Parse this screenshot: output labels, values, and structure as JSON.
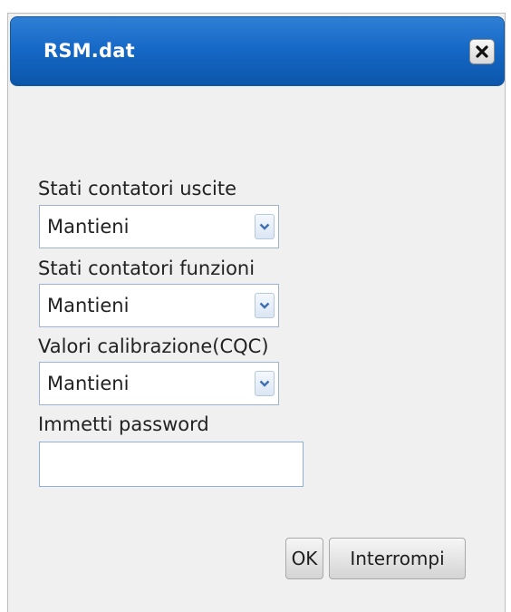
{
  "dialog": {
    "title": "RSM.dat",
    "close_icon": "close-x-icon"
  },
  "fields": [
    {
      "label": "Stati contatori uscite",
      "value": "Mantieni"
    },
    {
      "label": "Stati contatori funzioni",
      "value": "Mantieni"
    },
    {
      "label": "Valori calibrazione(CQC)",
      "value": "Mantieni"
    }
  ],
  "password": {
    "label": "Immetti password",
    "value": "",
    "placeholder": ""
  },
  "buttons": {
    "ok_label": "OK",
    "cancel_label": "Interrompi"
  },
  "colors": {
    "titlebar": "#1669c7",
    "dialog_bg": "#f0f0f0",
    "select_border": "#9db3cf"
  }
}
